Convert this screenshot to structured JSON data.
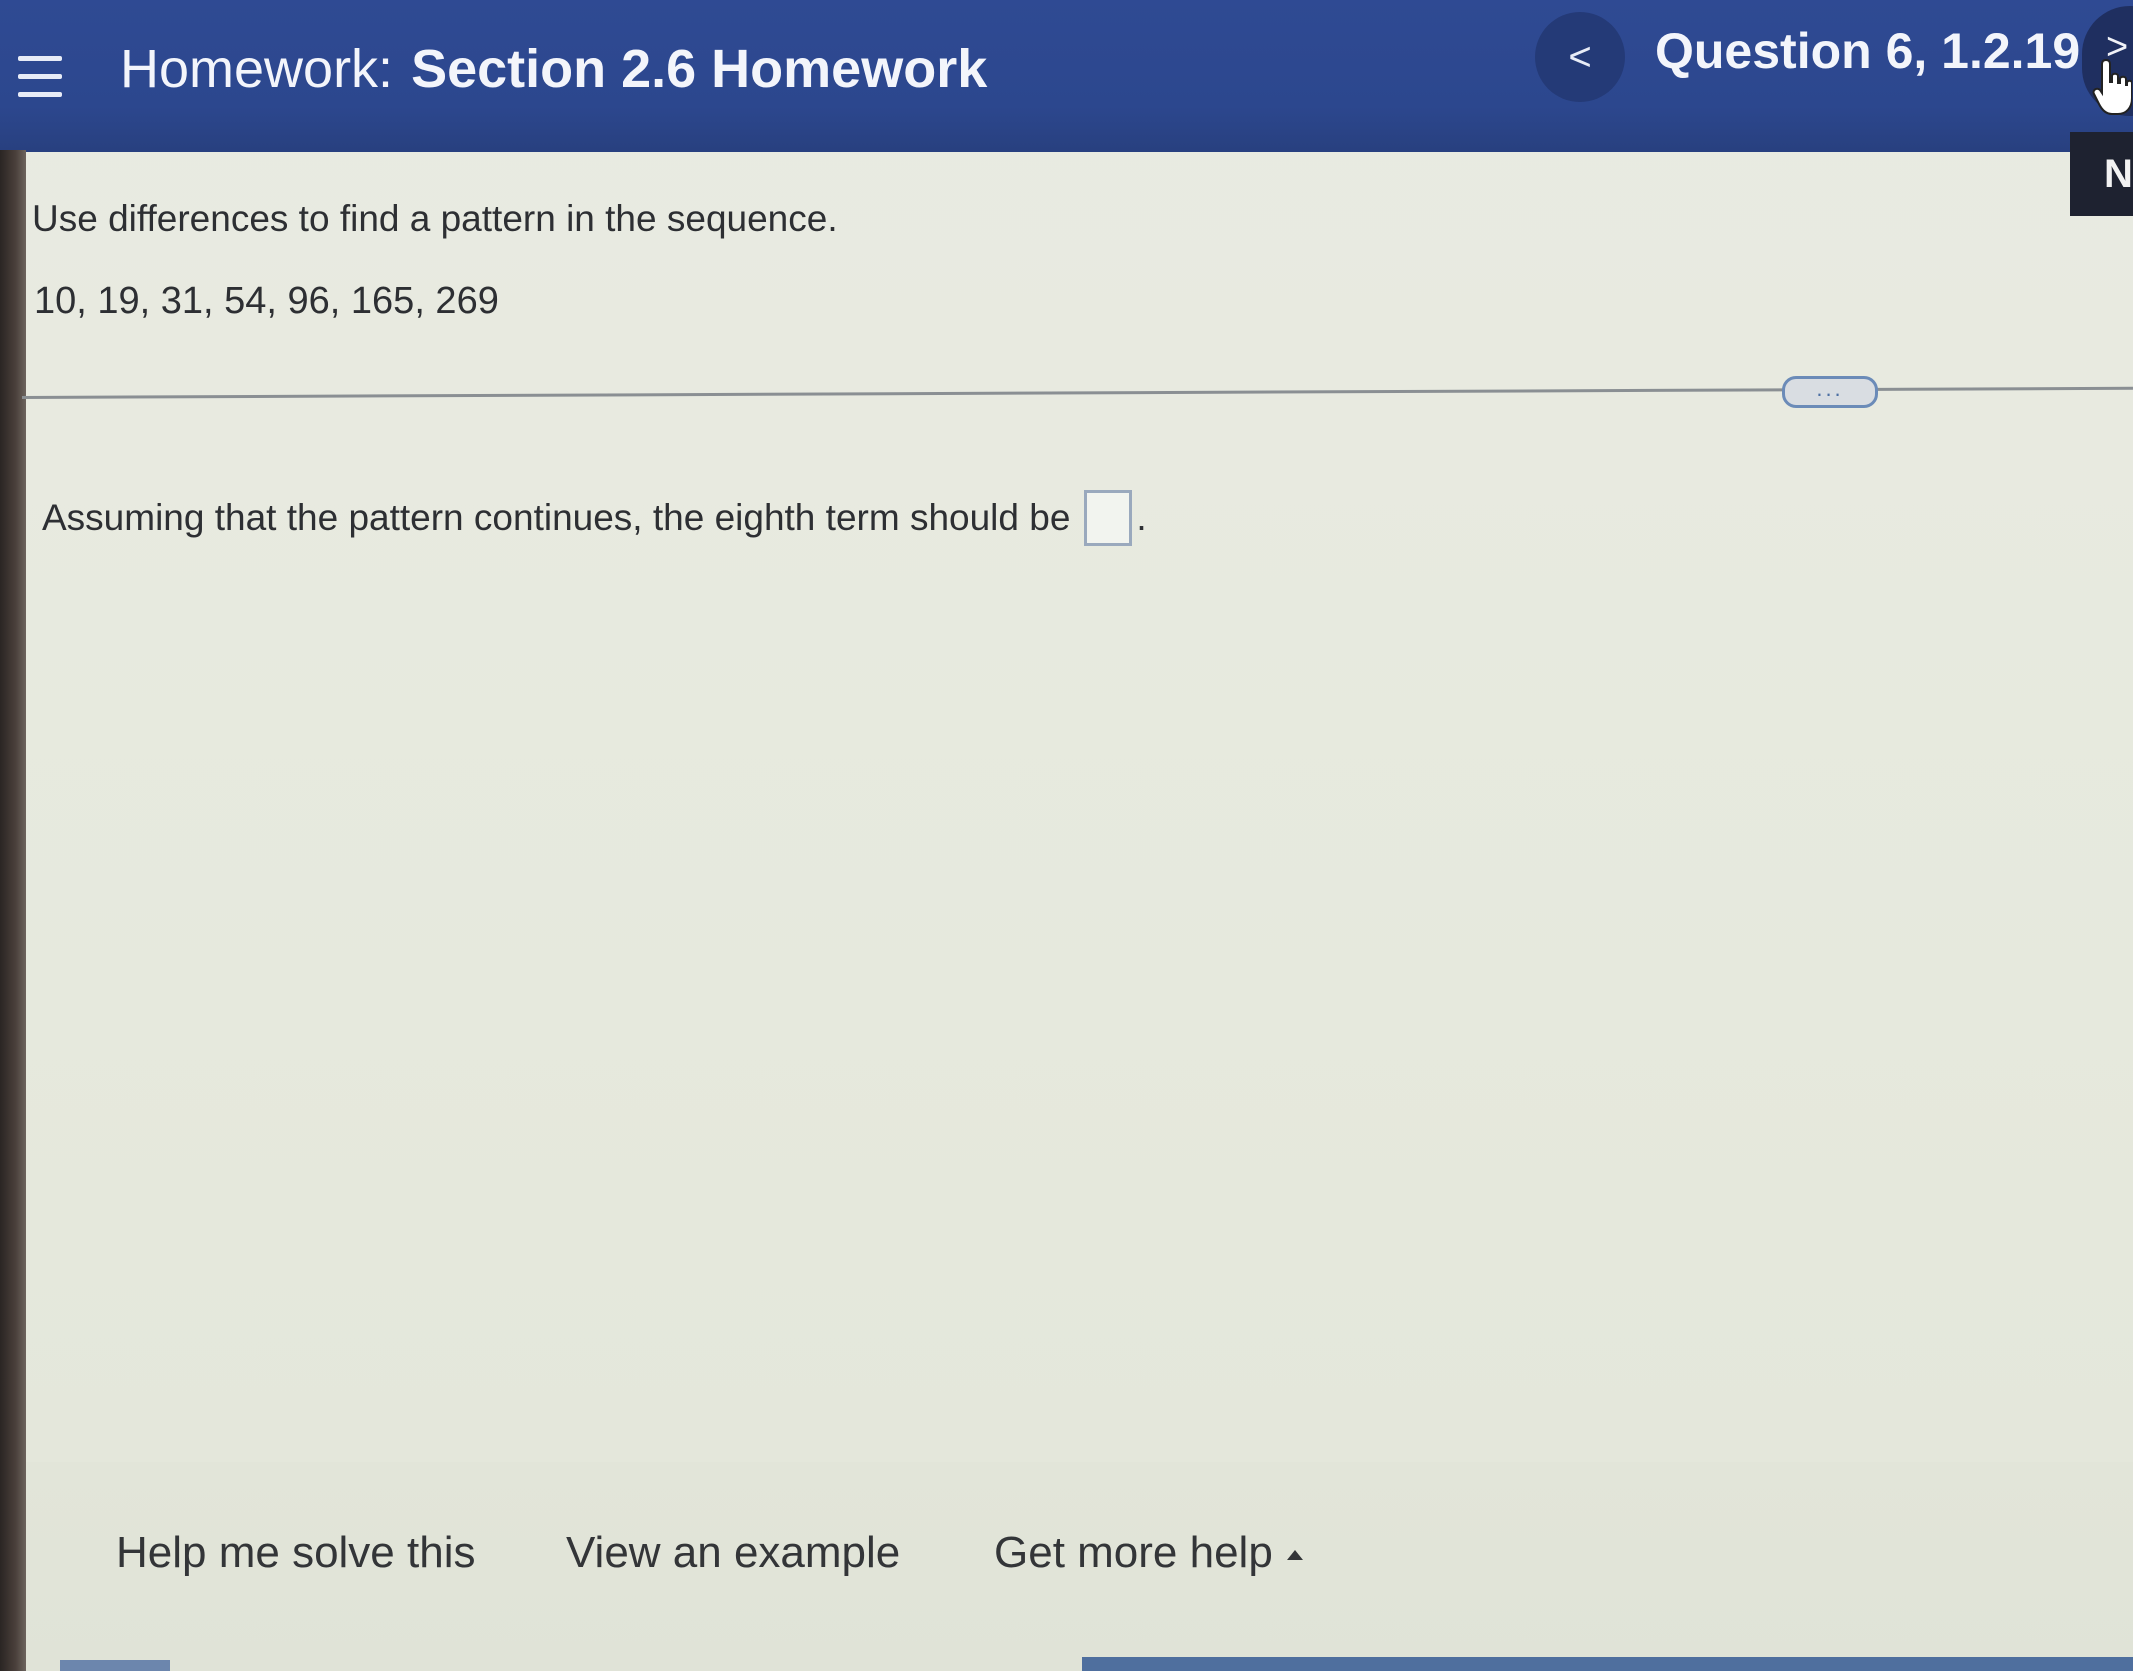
{
  "header": {
    "title_label": "Homework:",
    "title_name": "Section 2.6 Homework",
    "prev_label": "<",
    "question_label": "Question 6, 1.2.19",
    "next_label": ">",
    "side_tab_label": "N",
    "colors": {
      "header_bg": "#2f4a93",
      "header_text": "#f3f5fb"
    },
    "icons": {
      "menu": "hamburger-menu-icon",
      "cursor": "hand-pointer-icon"
    }
  },
  "question": {
    "instruction": "Use differences to find a pattern in the sequence.",
    "sequence": "10, 19, 31, 54, 96, 165, 269",
    "more_label": "...",
    "answer_prompt": "Assuming that the pattern continues, the eighth term should be",
    "answer_value": "",
    "answer_suffix": "."
  },
  "footer": {
    "help_solve": "Help me solve this",
    "view_example": "View an example",
    "more_help": "Get more help"
  }
}
